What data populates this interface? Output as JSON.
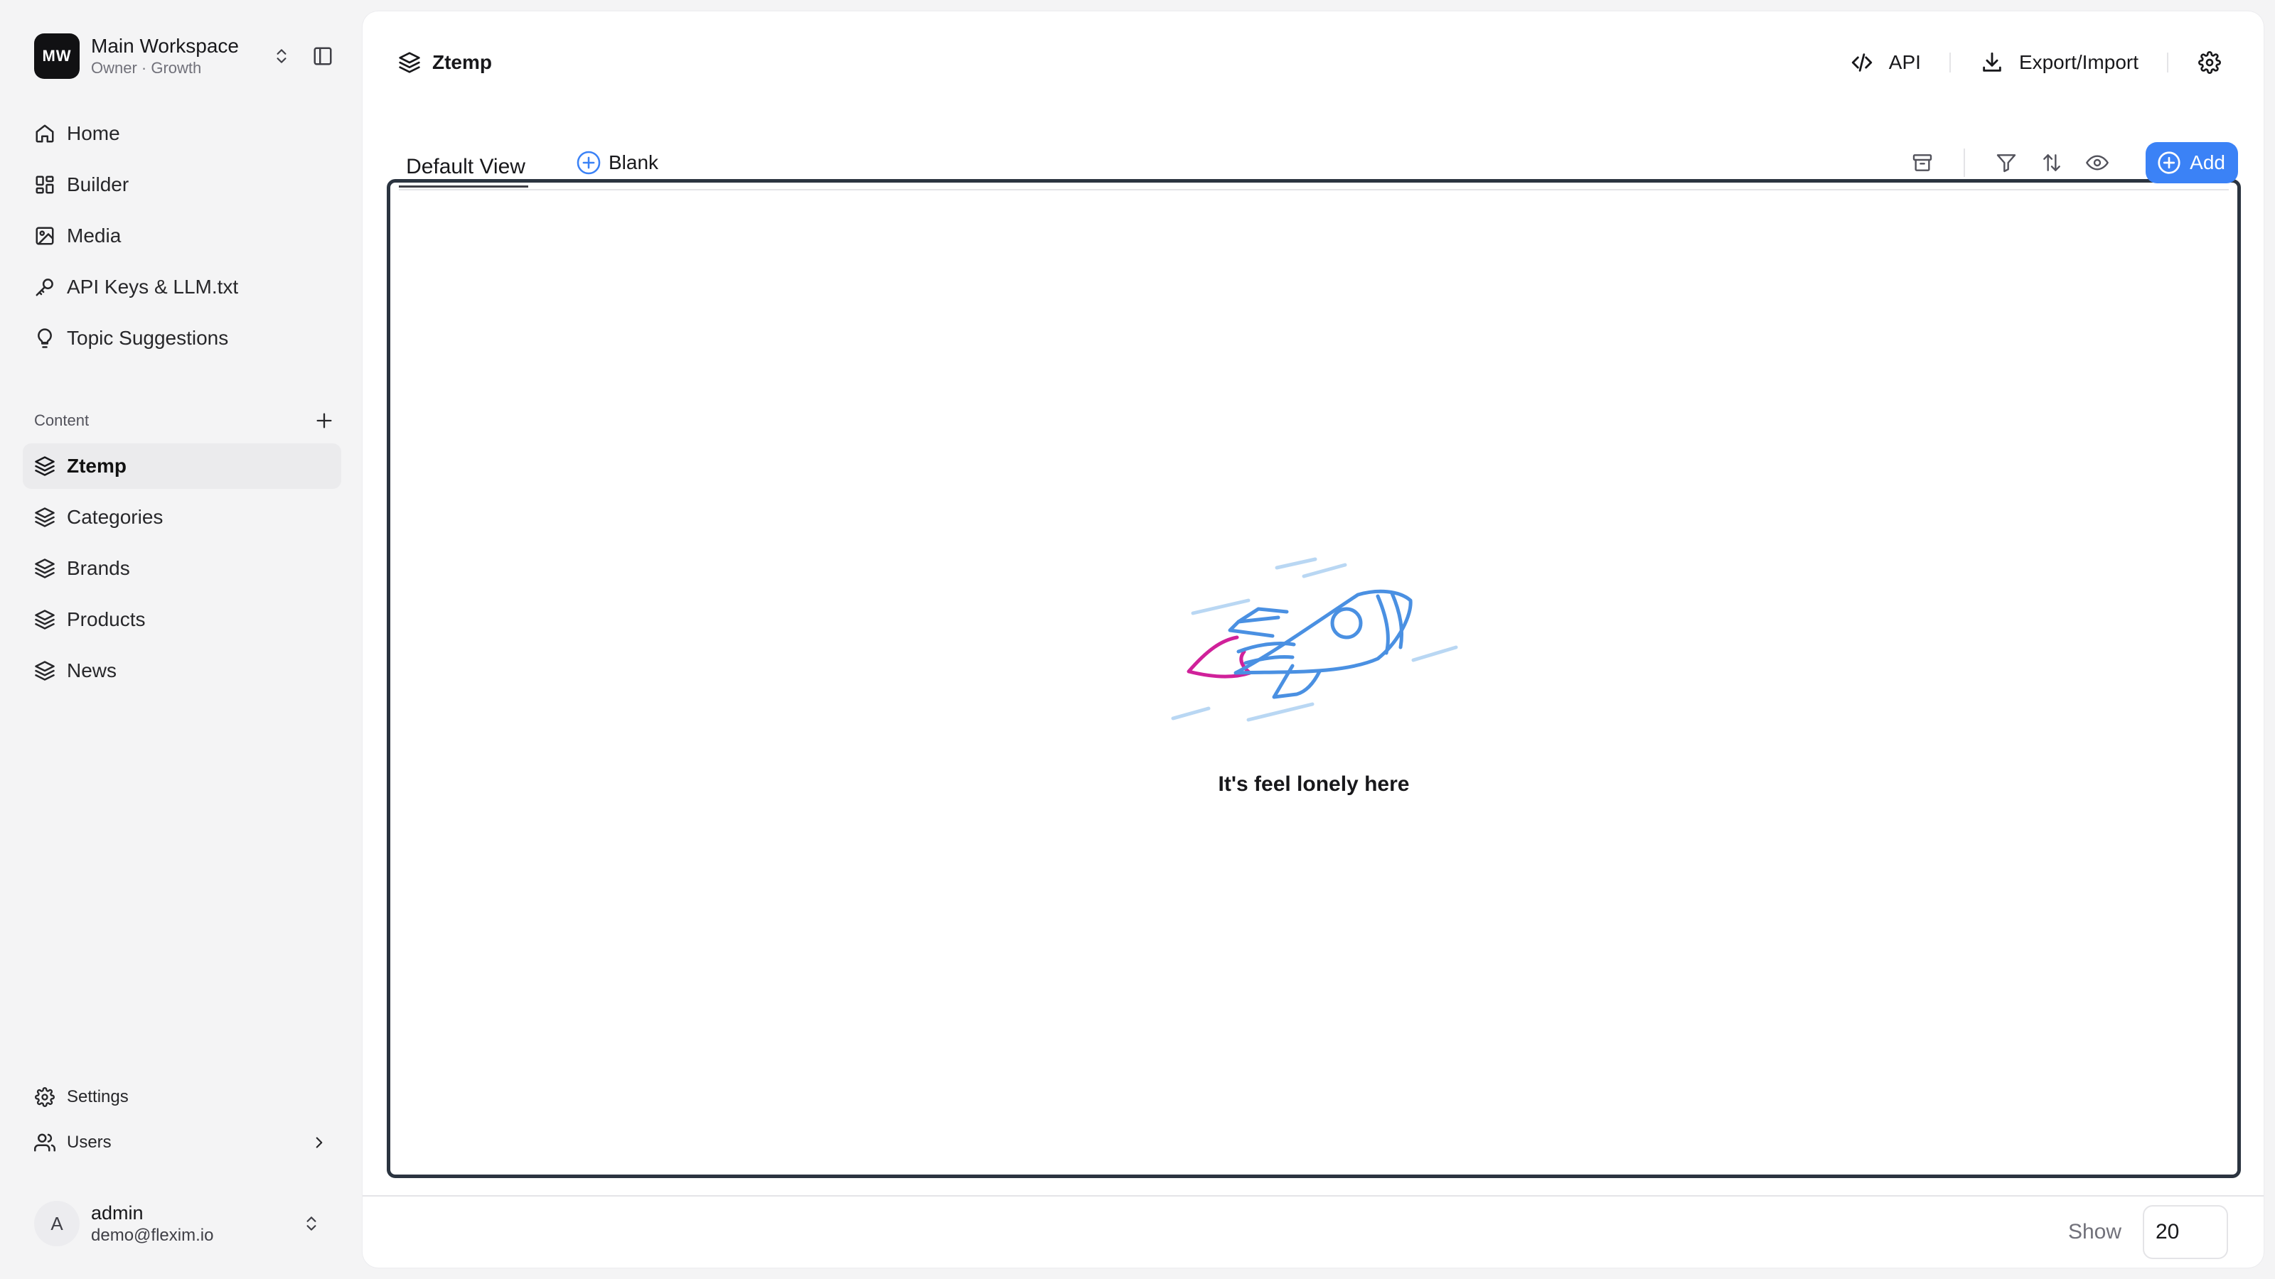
{
  "workspace": {
    "initials": "MW",
    "name": "Main Workspace",
    "subtitle": "Owner · Growth"
  },
  "sidebar": {
    "main_items": [
      {
        "label": "Home",
        "icon": "home-icon"
      },
      {
        "label": "Builder",
        "icon": "grid-icon"
      },
      {
        "label": "Media",
        "icon": "image-icon"
      },
      {
        "label": "API Keys & LLM.txt",
        "icon": "key-icon"
      },
      {
        "label": "Topic Suggestions",
        "icon": "lightbulb-icon"
      }
    ],
    "content_section_label": "Content",
    "content_items": [
      {
        "label": "Ztemp",
        "icon": "layers-icon",
        "active": true
      },
      {
        "label": "Categories",
        "icon": "layers-icon"
      },
      {
        "label": "Brands",
        "icon": "layers-icon"
      },
      {
        "label": "Products",
        "icon": "layers-icon"
      },
      {
        "label": "News",
        "icon": "layers-icon"
      }
    ],
    "bottom_items": [
      {
        "label": "Settings",
        "icon": "gear-icon"
      },
      {
        "label": "Users",
        "icon": "users-icon"
      }
    ]
  },
  "user": {
    "initial": "A",
    "name": "admin",
    "email": "demo@flexim.io"
  },
  "header": {
    "title": "Ztemp",
    "api_label": "API",
    "export_label": "Export/Import"
  },
  "views": {
    "default_tab": "Default View",
    "blank_tab": "Blank",
    "add_label": "Add"
  },
  "empty_state": {
    "message": "It's feel lonely here"
  },
  "footer": {
    "show_label": "Show",
    "page_size": "20"
  },
  "colors": {
    "accent": "#3b82f6",
    "rocket_body": "#4a90e2",
    "rocket_flame": "#d0219a",
    "speed_lines": "#b9d7f3"
  }
}
